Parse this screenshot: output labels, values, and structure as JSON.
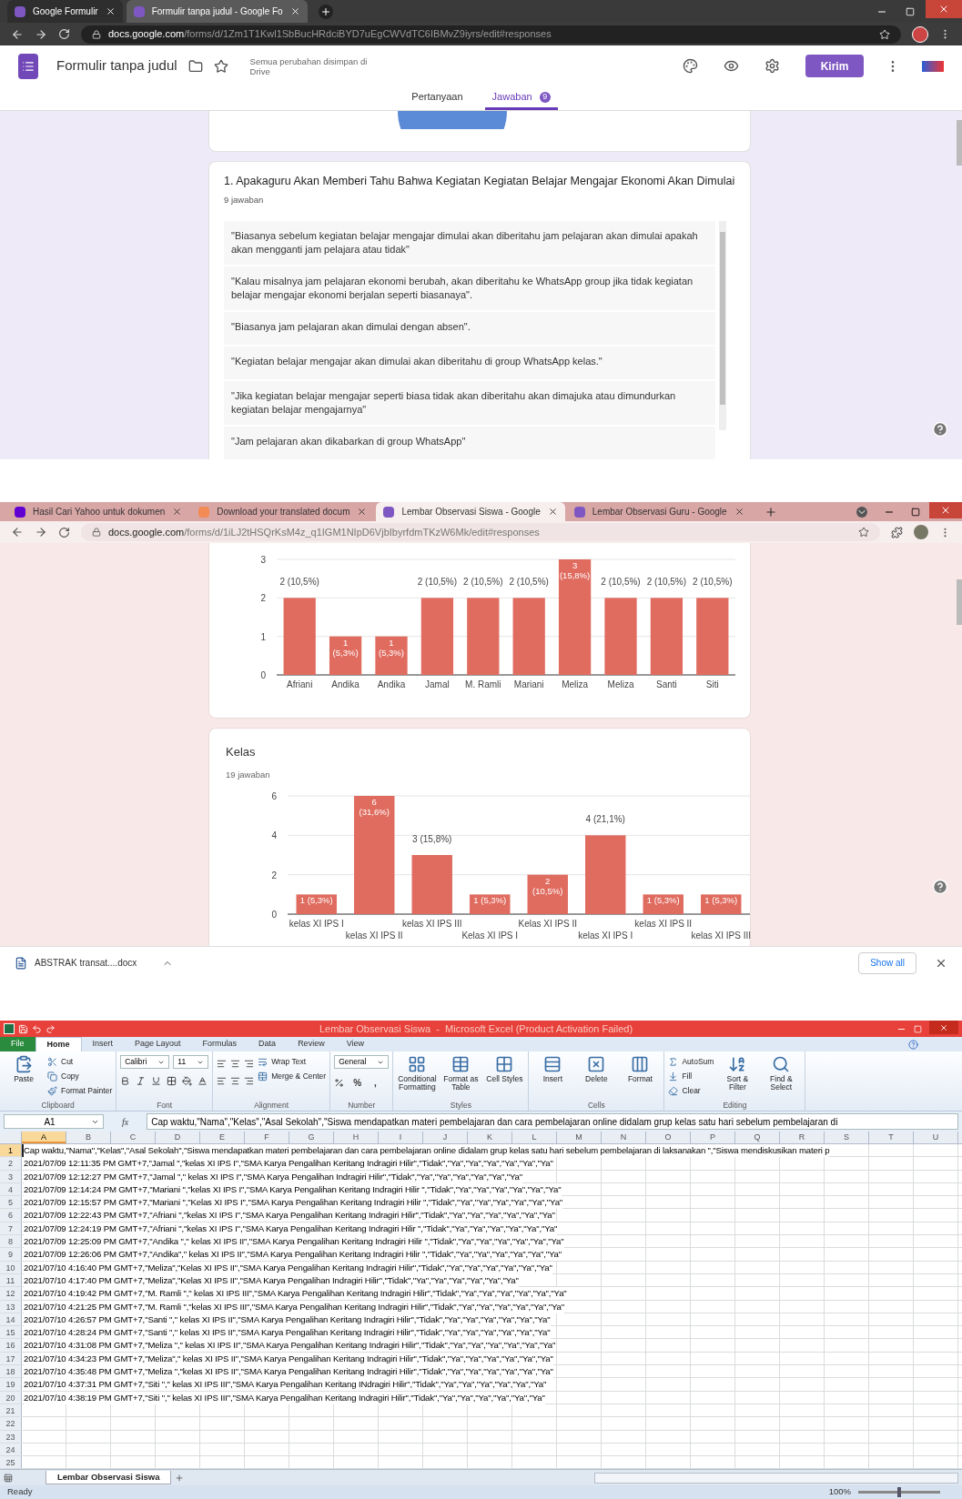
{
  "forms_window": {
    "tabs": [
      {
        "label": "Google Formulir",
        "selected": false
      },
      {
        "label": "Formulir tanpa judul - Google Fo",
        "selected": true
      }
    ],
    "url_host": "docs.google.com",
    "url_path": "/forms/d/1Zm1T1Kwl1SbBucHRdciBYD7uEgCWVdTC6IBMvZ9iyrs/edit#responses",
    "form_title": "Formulir tanpa judul",
    "save_status": "Semua perubahan disimpan di Drive",
    "send_button": "Kirim",
    "form_tabs": [
      {
        "label": "Pertanyaan",
        "selected": false
      },
      {
        "label": "Jawaban",
        "selected": true,
        "badge": "9"
      }
    ],
    "question": {
      "title": "1. Apakaguru Akan Memberi Tahu Bahwa Kegiatan Kegiatan Belajar Mengajar Ekonomi Akan Dimulai",
      "count": "9 jawaban",
      "responses": [
        "\"Biasanya sebelum kegiatan belajar mengajar dimulai akan diberitahu jam pelajaran akan dimulai apakah akan mengganti jam pelajara atau tidak\"",
        "\"Kalau misalnya jam pelajaran ekonomi berubah, akan diberitahu ke WhatsApp group jika tidak kegiatan belajar mengajar ekonomi berjalan seperti biasanaya\".",
        "\"Biasanya jam pelajaran akan dimulai dengan absen\".",
        "\"Kegiatan belajar mengajar akan dimulai akan diberitahu di group WhatsApp kelas.\"",
        "\"Jika kegiatan belajar mengajar seperti biasa tidak akan diberitahu akan dimajuka atau dimundurkan kegiatan belajar mengajarnya\"",
        "\"Jam pelajaran akan dikabarkan di group WhatsApp\""
      ]
    }
  },
  "chart_window": {
    "tabs": [
      {
        "label": "Hasil Cari Yahoo untuk dokumen",
        "selected": false
      },
      {
        "label": "Download your translated docum",
        "selected": false
      },
      {
        "label": "Lembar Observasi Siswa - Google",
        "selected": true
      },
      {
        "label": "Lembar Observasi Guru - Google",
        "selected": false
      }
    ],
    "url_host": "docs.google.com",
    "url_path": "/forms/d/1iLJ2tHSQrKsM4z_q1IGM1NIpD6VjbIbyrfdmTKzW6Mk/edit#responses",
    "name_card": {
      "chart_data": {
        "type": "bar",
        "categories": [
          "Afriani",
          "Andika",
          "Andika",
          "Jamal",
          "M. Ramli",
          "Mariani",
          "Meliza",
          "Meliza",
          "Santi",
          "Siti"
        ],
        "series": [
          {
            "color": "#e06c60",
            "values": [
              2,
              1,
              1,
              2,
              2,
              2,
              3,
              2,
              2,
              2
            ]
          }
        ],
        "ylim": [
          0,
          3
        ],
        "yticks": [
          0,
          1,
          2,
          3
        ],
        "value_labels": [
          "2 (10,5%)",
          "1 (5,3%)",
          "1 (5,3%)",
          "2 (10,5%)",
          "2 (10,5%)",
          "2 (10,5%)",
          "3 (15,8%)",
          "2 (10,5%)",
          "2 (10,5%)",
          "2 (10,5%)"
        ]
      }
    },
    "kelas_card": {
      "title": "Kelas",
      "count": "19 jawaban",
      "chart_data": {
        "type": "bar",
        "categories": [
          "kelas XI IPS I",
          "kelas XI IPS II",
          "kelas XI IPS III",
          "Kelas XI IPS I",
          "Kelas XI IPS II",
          "kelas XI IPS I",
          "kelas XI IPS II",
          "kelas XI IPS III"
        ],
        "series": [
          {
            "color": "#e06c60",
            "values": [
              1,
              6,
              3,
              1,
              2,
              4,
              1,
              1
            ]
          }
        ],
        "ylim": [
          0,
          6
        ],
        "yticks": [
          0,
          2,
          4,
          6
        ],
        "value_labels": [
          "1 (5,3%)",
          "6 (31,6%)",
          "3 (15,8%)",
          "1 (5,3%)",
          "2 (10,5%)",
          "4 (21,1%)",
          "1 (5,3%)",
          "1 (5,3%)"
        ]
      }
    }
  },
  "download_bar": {
    "file": "ABSTRAK transat....docx",
    "show_all": "Show all"
  },
  "excel": {
    "title": "Lembar Observasi Siswa  -  Microsoft Excel (Product Activation Failed)",
    "menu_tabs": [
      {
        "label": "File",
        "kind": "file",
        "selected": false
      },
      {
        "label": "Home",
        "kind": "tab",
        "selected": true
      },
      {
        "label": "Insert",
        "kind": "tab",
        "selected": false
      },
      {
        "label": "Page Layout",
        "kind": "tab",
        "selected": false
      },
      {
        "label": "Formulas",
        "kind": "tab",
        "selected": false
      },
      {
        "label": "Data",
        "kind": "tab",
        "selected": false
      },
      {
        "label": "Review",
        "kind": "tab",
        "selected": false
      },
      {
        "label": "View",
        "kind": "tab",
        "selected": false
      }
    ],
    "ribbon": [
      {
        "name": "Clipboard",
        "items": [
          {
            "kind": "large",
            "label": "Paste"
          },
          {
            "kind": "small",
            "label": "Cut"
          },
          {
            "kind": "small",
            "label": "Copy"
          },
          {
            "kind": "small",
            "label": "Format Painter"
          }
        ]
      },
      {
        "name": "Font",
        "items": [
          {
            "kind": "field",
            "label": "Calibri"
          },
          {
            "kind": "field",
            "label": "11"
          }
        ]
      },
      {
        "name": "Alignment",
        "items": [
          {
            "kind": "small",
            "label": "Wrap Text"
          },
          {
            "kind": "small",
            "label": "Merge & Center"
          }
        ]
      },
      {
        "name": "Number",
        "items": [
          {
            "kind": "field",
            "label": "General"
          },
          {
            "kind": "glyph",
            "label": "%"
          },
          {
            "kind": "glyph",
            "label": ","
          }
        ]
      },
      {
        "name": "Styles",
        "items": [
          {
            "kind": "large",
            "label": "Conditional Formatting"
          },
          {
            "kind": "large",
            "label": "Format as Table"
          },
          {
            "kind": "large",
            "label": "Cell Styles"
          }
        ]
      },
      {
        "name": "Cells",
        "items": [
          {
            "kind": "large",
            "label": "Insert"
          },
          {
            "kind": "large",
            "label": "Delete"
          },
          {
            "kind": "large",
            "label": "Format"
          }
        ]
      },
      {
        "name": "Editing",
        "items": [
          {
            "kind": "small",
            "label": "AutoSum"
          },
          {
            "kind": "small",
            "label": "Fill"
          },
          {
            "kind": "small",
            "label": "Clear"
          },
          {
            "kind": "large",
            "label": "Sort & Filter"
          },
          {
            "kind": "large",
            "label": "Find & Select"
          }
        ]
      }
    ],
    "name_box": "A1",
    "fx": "fx",
    "formula": "Cap waktu,\"Nama\",\"Kelas\",\"Asal Sekolah\",\"Siswa mendapatkan materi pembelajaran dan cara pembelajaran online didalam grup kelas satu hari sebelum pembelajaran di",
    "columns": [
      {
        "label": "A",
        "selected": true
      },
      {
        "label": "B",
        "selected": false
      },
      {
        "label": "C",
        "selected": false
      },
      {
        "label": "D",
        "selected": false
      },
      {
        "label": "E",
        "selected": false
      },
      {
        "label": "F",
        "selected": false
      },
      {
        "label": "G",
        "selected": false
      },
      {
        "label": "H",
        "selected": false
      },
      {
        "label": "I",
        "selected": false
      },
      {
        "label": "J",
        "selected": false
      },
      {
        "label": "K",
        "selected": false
      },
      {
        "label": "L",
        "selected": false
      },
      {
        "label": "M",
        "selected": false
      },
      {
        "label": "N",
        "selected": false
      },
      {
        "label": "O",
        "selected": false
      },
      {
        "label": "P",
        "selected": false
      },
      {
        "label": "Q",
        "selected": false
      },
      {
        "label": "R",
        "selected": false
      },
      {
        "label": "S",
        "selected": false
      },
      {
        "label": "T",
        "selected": false
      },
      {
        "label": "U",
        "selected": false
      }
    ],
    "rows": [
      {
        "number": "1",
        "selected": true,
        "text": "Cap waktu,\"Nama\",\"Kelas\",\"Asal Sekolah\",\"Siswa mendapatkan materi pembelajaran dan cara pembelajaran online didalam grup kelas satu hari sebelum pembelajaran di laksanakan \",\"Siswa mendiskusikan materi p"
      },
      {
        "number": "2",
        "selected": false,
        "text": "2021/07/09 12:11:35 PM GMT+7,\"Jamal \",\"kelas XI IPS I\",\"SMA Karya Pengalihan Keritang Indragiri Hilir\",\"Tidak\",\"Ya\",\"Ya\",\"Ya\",\"Ya\",\"Ya\",\"Ya\""
      },
      {
        "number": "3",
        "selected": false,
        "text": "2021/07/09 12:12:27 PM GMT+7,\"Jamal \",\" kelas XI IPS I\",\"SMA Karya Pengalihan Indragiri Hilir\",\"Tidak\",\"Ya\",\"Ya\",\"Ya\",\"Ya\",\"Ya\",\"Ya\""
      },
      {
        "number": "4",
        "selected": false,
        "text": "2021/07/09 12:14:24 PM GMT+7,\"Mariani \",\"kelas XI IPS I\",\"SMA Karya Pengalihan Keritang Indragiri Hilir \",\"Tidak\",\"Ya\",\"Ya\",\"Ya\",\"Ya\",\"Ya\",\"Ya\""
      },
      {
        "number": "5",
        "selected": false,
        "text": "2021/07/09 12:15:57 PM GMT+7,\"Mariani \",\"Kelas XI IPS I\",\"SMA Karya Pengalihan Keritang Indragiri Hilir \",\"Tidak\",\"Ya\",\"Ya\",\"Ya\",\"Ya\",\"Ya\",\"Ya\""
      },
      {
        "number": "6",
        "selected": false,
        "text": "2021/07/09 12:22:43 PM GMT+7,\"Afriani \",\"kelas XI IPS I\",\"SMA Karya Pengalihan Keritang Indragiri Hilir\",\"Tidak\",\"Ya\",\"Ya\",\"Ya\",\"Ya\",\"Ya\",\"Ya\""
      },
      {
        "number": "7",
        "selected": false,
        "text": "2021/07/09 12:24:19 PM GMT+7,\"Afriani \",\"kelas XI IPS I\",\"SMA Karya Pengalihan Keritang Indragiri Hilir \",\"Tidak\",\"Ya\",\"Ya\",\"Ya\",\"Ya\",\"Ya\",\"Ya\""
      },
      {
        "number": "8",
        "selected": false,
        "text": "2021/07/09 12:25:09 PM GMT+7,\"Andika \",\" kelas XI IPS II\",\"SMA Karya Pengalihan Keritang Indragiri Hilir \",\"Tidak\",\"Ya\",\"Ya\",\"Ya\",\"Ya\",\"Ya\",\"Ya\""
      },
      {
        "number": "9",
        "selected": false,
        "text": "2021/07/09 12:26:06 PM GMT+7,\"Andika\",\" kelas XI IPS II\",\"SMA Karya Pengalihan Keritang Indragiri Hilir \",\"Tidak\",\"Ya\",\"Ya\",\"Ya\",\"Ya\",\"Ya\",\"Ya\""
      },
      {
        "number": "10",
        "selected": false,
        "text": "2021/07/10 4:16:40 PM GMT+7,\"Meliza\",\"Kelas XI IPS II\",\"SMA Karya Pengalihan Keritang Indragiri Hilir\",\"Tidak\",\"Ya\",\"Ya\",\"Ya\",\"Ya\",\"Ya\",\"Ya\""
      },
      {
        "number": "11",
        "selected": false,
        "text": "2021/07/10 4:17:40 PM GMT+7,\"Meliza\",\"Kelas XI IPS II\",\"SMA Karya Pengalihan Indragiri Hilir\",\"Tidak\",\"Ya\",\"Ya\",\"Ya\",\"Ya\",\"Ya\",\"Ya\""
      },
      {
        "number": "12",
        "selected": false,
        "text": "2021/07/10 4:19:42 PM GMT+7,\"M. Ramli \",\" kelas XI IPS III\",\"SMA Karya Pengalihan Keritang Indragiri Hilir\",\"Tidak\",\"Ya\",\"Ya\",\"Ya\",\"Ya\",\"Ya\",\"Ya\""
      },
      {
        "number": "13",
        "selected": false,
        "text": "2021/07/10 4:21:25 PM GMT+7,\"M. Ramli \",\"kelas XI IPS III\",\"SMA Karya Pengalihan Keritang Indragiri Hilir\",\"Tidak\",\"Ya\",\"Ya\",\"Ya\",\"Ya\",\"Ya\",\"Ya\""
      },
      {
        "number": "14",
        "selected": false,
        "text": "2021/07/10 4:26:57 PM GMT+7,\"Santi \",\" kelas XI IPS II\",\"SMA Karya Pengalihan Keritang Indragiri Hilir\",\"Tidak\",\"Ya\",\"Ya\",\"Ya\",\"Ya\",\"Ya\",\"Ya\""
      },
      {
        "number": "15",
        "selected": false,
        "text": "2021/07/10 4:28:24 PM GMT+7,\"Santi \",\" kelas XI IPS II\",\"SMA Karya Pengalihan Keritang Indragiri Hilir\",\"Tidak\",\"Ya\",\"Ya\",\"Ya\",\"Ya\",\"Ya\",\"Ya\""
      },
      {
        "number": "16",
        "selected": false,
        "text": "2021/07/10 4:31:08 PM GMT+7,\"Meliza \",\" kelas XI IPS II\",\"SMA Karya Pengalihan Keritang Indragiri Hilir\",\"Tidak\",\"Ya\",\"Ya\",\"Ya\",\"Ya\",\"Ya\",\"Ya\""
      },
      {
        "number": "17",
        "selected": false,
        "text": "2021/07/10 4:34:23 PM GMT+7,\"Meliza\",\" kelas XI IPS II\",\"SMA Karya Pengalihan Keritang Indragiri Hilir\",\"Tidak\",\"Ya\",\"Ya\",\"Ya\",\"Ya\",\"Ya\",\"Ya\""
      },
      {
        "number": "18",
        "selected": false,
        "text": "2021/07/10 4:35:48 PM GMT+7,\"Meliza \",\"kelas XI IPS II\",\"SMA Karya Pengalihan Keritang Indragiri Hilir\",\"Tidak\",\"Ya\",\"Ya\",\"Ya\",\"Ya\",\"Ya\",\"Ya\""
      },
      {
        "number": "19",
        "selected": false,
        "text": "2021/07/10 4:37:31 PM GMT+7,\"Siti \",\" kelas XI IPS III\",\"SMA Karya Pengalihan Keritang INdragiri Hilir\",\"Tidak\",\"Ya\",\"Ya\",\"Ya\",\"Ya\",\"Ya\",\"Ya\""
      },
      {
        "number": "20",
        "selected": false,
        "text": "2021/07/10 4:38:19 PM GMT+7,\"Siti \",\" kelas XI IPS III\",\"SMA Karya Pengalihan Keritang Indragiri Hilir\",\"Tidak\",\"Ya\",\"Ya\",\"Ya\",\"Ya\",\"Ya\",\"Ya\""
      },
      {
        "number": "21",
        "selected": false
      },
      {
        "number": "22",
        "selected": false
      },
      {
        "number": "23",
        "selected": false
      },
      {
        "number": "24",
        "selected": false
      },
      {
        "number": "25",
        "selected": false
      }
    ],
    "sheet_tab": "Lembar Observasi Siswa",
    "status": "Ready",
    "zoom": "100%",
    "zoom_slider": {
      "level": 0.5
    }
  }
}
